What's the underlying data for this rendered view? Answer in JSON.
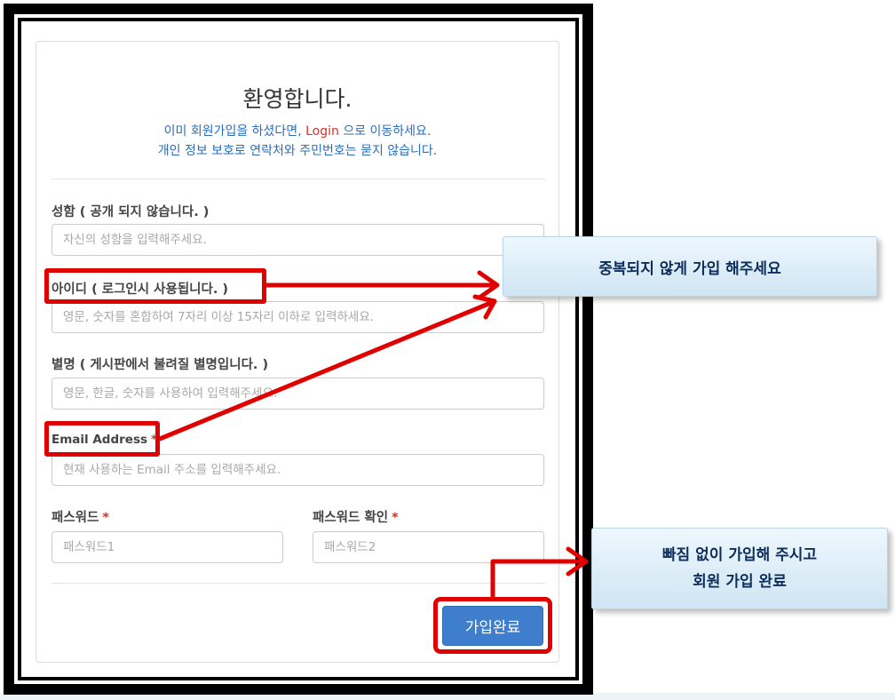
{
  "form": {
    "title": "환영합니다.",
    "subtitle_line1_pre": "이미 회원가입을 하셨다면, ",
    "subtitle_line1_link": "Login",
    "subtitle_line1_post": " 으로 이동하세요.",
    "subtitle_line2": "개인 정보 보호로 연락처와 주민번호는 묻지 않습니다."
  },
  "fields": {
    "name": {
      "label": "성함 ( 공개 되지 않습니다. )",
      "placeholder": "자신의 성함을 입력해주세요."
    },
    "userid": {
      "label": "아이디 ( 로그인시 사용됩니다. )",
      "placeholder": "영문, 숫자를 혼합하여 7자리 이상 15자리 이하로 입력하세요."
    },
    "nickname": {
      "label": "별명 ( 게시판에서 불려질 별명입니다. )",
      "placeholder": "영문, 한글, 숫자를 사용하여 입력해주세요."
    },
    "email": {
      "label": "Email Address",
      "required": "*",
      "placeholder": "현재 사용하는 Email 주소를 입력해주세요."
    },
    "password": {
      "label": "패스워드",
      "required": "*",
      "placeholder": "패스워드1"
    },
    "password_confirm": {
      "label": "패스워드 확인",
      "required": "*",
      "placeholder": "패스워드2"
    }
  },
  "submit_label": "가입완료",
  "callouts": {
    "duplicate": "중복되지 않게 가입 해주세요",
    "complete_line1": "빠짐 없이 가입해 주시고",
    "complete_line2": "회원 가입 완료"
  },
  "colors": {
    "highlight": "#e00000",
    "button": "#3e7ecc",
    "link": "#d9322b",
    "subtitle": "#2a6ebb",
    "callout_text": "#0d2d5c"
  }
}
